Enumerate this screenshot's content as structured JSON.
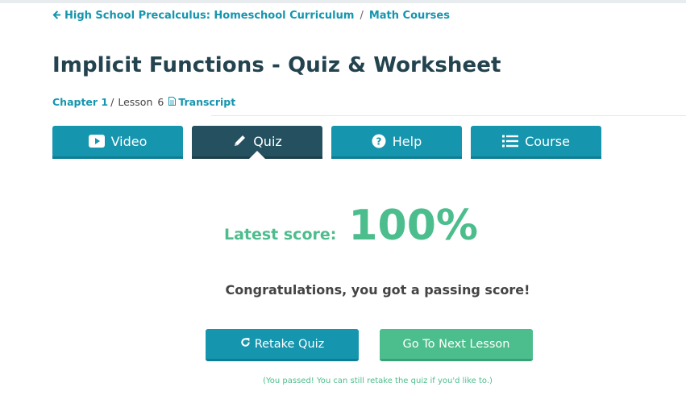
{
  "breadcrumb": {
    "items": [
      "High School Precalculus: Homeschool Curriculum",
      "Math Courses"
    ],
    "separator": "/"
  },
  "page": {
    "title": "Implicit Functions - Quiz & Worksheet"
  },
  "meta": {
    "chapter": "Chapter 1",
    "separator": "/",
    "lesson_label": "Lesson",
    "lesson_number": "6",
    "transcript": "Transcript"
  },
  "tabs": [
    {
      "label": "Video",
      "icon": "video-icon"
    },
    {
      "label": "Quiz",
      "icon": "pencil-icon",
      "active": true
    },
    {
      "label": "Help",
      "icon": "help-icon"
    },
    {
      "label": "Course",
      "icon": "list-icon"
    }
  ],
  "score": {
    "label": "Latest score:",
    "value": "100%"
  },
  "message": "Congratulations, you got a passing score!",
  "buttons": {
    "retake": "Retake Quiz",
    "next": "Go To Next Lesson"
  },
  "note": "(You passed! You can still retake the quiz if you'd like to.)",
  "colors": {
    "accent": "#1595ae",
    "active_tab": "#24505f",
    "success": "#4cbd8c",
    "title": "#23434f"
  }
}
